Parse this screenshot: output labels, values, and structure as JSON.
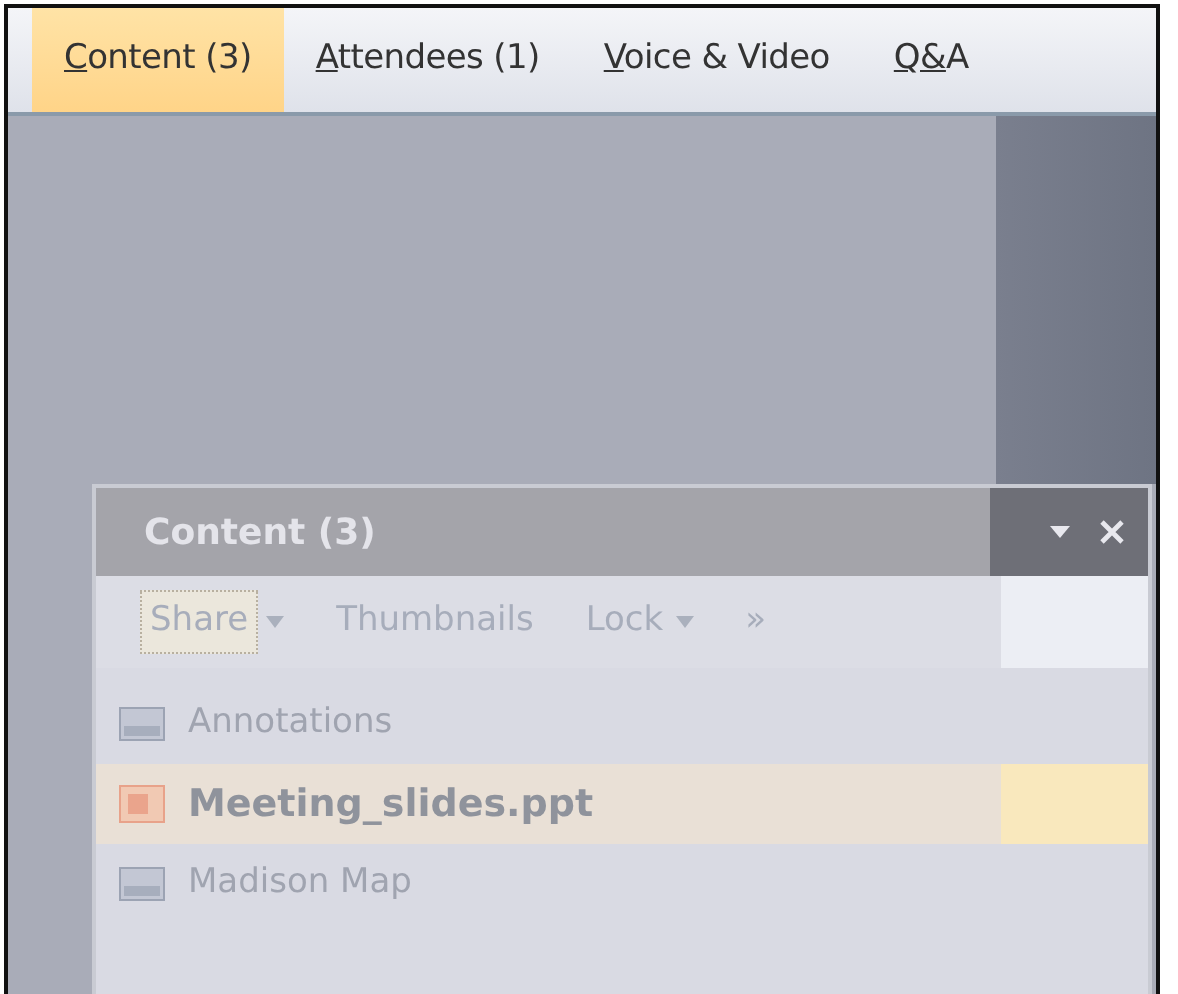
{
  "tabs": [
    {
      "label": "Content (3)",
      "selected": true
    },
    {
      "label": "Attendees (1)",
      "selected": false
    },
    {
      "label": "Voice & Video",
      "selected": false
    },
    {
      "label": "Q&A",
      "selected": false
    }
  ],
  "panel": {
    "title": "Content (3)",
    "toolbar": [
      {
        "kind": "split",
        "label": "Share"
      },
      {
        "kind": "button",
        "label": "Thumbnails"
      },
      {
        "kind": "dropdown",
        "label": "Lock"
      },
      {
        "kind": "button",
        "label": "»"
      }
    ],
    "items": [
      {
        "kind": "image",
        "label": "Annotations",
        "selected": false
      },
      {
        "kind": "slides",
        "label": "Meeting_slides.ppt",
        "selected": true
      },
      {
        "kind": "image",
        "label": "Madison Map",
        "selected": false
      }
    ]
  }
}
